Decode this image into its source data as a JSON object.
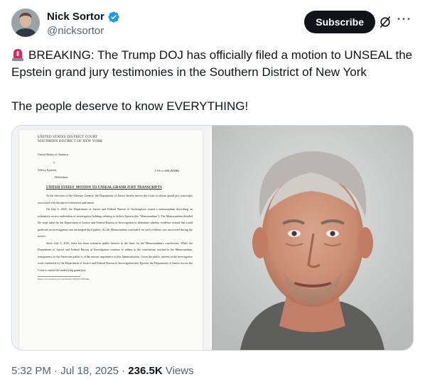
{
  "author": {
    "display_name": "Nick Sortor",
    "handle": "@nicksortor",
    "verified_color": "#1d9bf0"
  },
  "actions": {
    "subscribe_label": "Subscribe",
    "grok_icon": "grok-slash-icon",
    "more_icon": "more-dots-icon"
  },
  "tweet": {
    "line1": "BREAKING: The Trump DOJ has officially filed a motion to UNSEAL the Epstein grand jury testimonies in the Southern District of New York",
    "line2": "The people deserve to know EVERYTHING!",
    "emoji": "rotating-light"
  },
  "document": {
    "court_line1": "UNITED STATES DISTRICT COURT",
    "court_line2": "SOUTHERN DISTRICT OF NEW YORK",
    "party1": "United States of America",
    "versus": "v.",
    "party2": "Jeffrey Epstein,",
    "party2_role": "Defendant.",
    "case_no": "1:19-cr-490 (RMB)",
    "heading": "UNITED STATES' MOTION TO UNSEAL GRAND JURY TRANSCRIPTS",
    "para1": "At the direction of the Attorney General, the Department of Justice hereby moves the Court to release grand jury transcripts associated with the above-referenced indictment.",
    "para2": "On July 6, 2025, the Department of Justice and Federal Bureau of Investigation issued a memorandum describing an exhaustive review undertaken of investigative holdings relating to Jeffrey Epstein (the \"Memorandum\"). The Memorandum detailed the steps taken by the Department of Justice and Federal Bureau of Investigation to determine whether evidence existed that could predicate an investigation into uncharged third parties. As the Memorandum concluded, no such evidence was uncovered during the review.",
    "para3": "Since July 6, 2025, there has been extensive public interest in the basis for the Memorandum's conclusions. While the Department of Justice and Federal Bureau of Investigation continue to adhere to the conclusions reached in the Memorandum, transparency to the American public is of the utmost importance to this Administration. Given the public interest in the investigative work conducted by the Department of Justice and Federal Bureau of Investigation into Epstein, the Department of Justice moves the Court to unseal the underlying grand jury",
    "footnote": "https://www.justice.gov/opa/media/1407001/dl?inline"
  },
  "footer": {
    "time": "5:32 PM",
    "sep1": " · ",
    "date": "Jul 18, 2025",
    "sep2": " · ",
    "views_count": "236.5K",
    "views_label": " Views"
  }
}
